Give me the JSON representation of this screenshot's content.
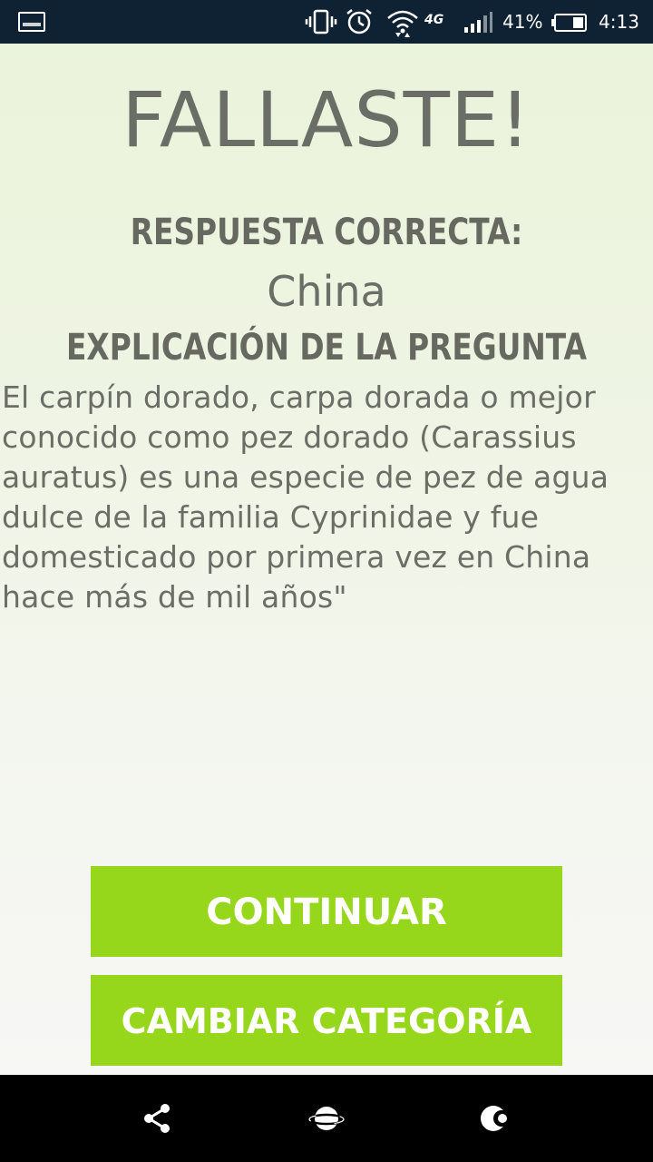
{
  "status_bar": {
    "battery": "41%",
    "time": "4:13",
    "network": "4G"
  },
  "result": {
    "title": "FALLASTE!",
    "correct_label": "RESPUESTA CORRECTA:",
    "correct_answer": "China",
    "explanation_label": "EXPLICACIÓN DE LA PREGUNTA",
    "explanation_text": "El carpín dorado, carpa dorada o mejor conocido como pez dorado (Carassius auratus) es una especie de pez de agua dulce de la familia Cyprinidae y fue domesticado por primera vez en China hace más de mil años\""
  },
  "buttons": {
    "continue": "CONTINUAR",
    "change_category": "CAMBIAR CATEGORÍA"
  },
  "colors": {
    "accent": "#97d71b",
    "text": "#6b6e66",
    "status_bar": "#0f2233"
  },
  "icons": {
    "status": [
      "gallery-icon",
      "vibrate-icon",
      "alarm-icon",
      "wifi-icon",
      "signal-icon",
      "battery-icon"
    ],
    "nav": [
      "share-icon",
      "planet-icon",
      "moon-icon"
    ]
  }
}
